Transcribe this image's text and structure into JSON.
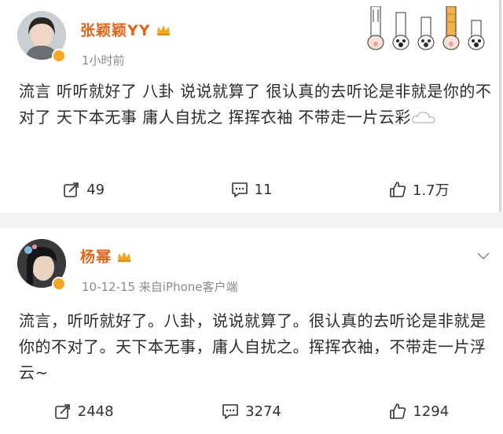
{
  "posts": [
    {
      "author": "张颖颖YY",
      "time": "1小时前",
      "text": "流言 听听就好了 八卦 说说就算了 很认真的去听论是非就是你的不对了 天下本无事 庸人自扰之 挥挥衣袖 不带走一片云彩",
      "repost_count": "49",
      "comment_count": "11",
      "like_count": "1.7万"
    },
    {
      "author": "杨幂",
      "time": "10-12-15 来自iPhone客户端",
      "text": "流言，听听就好了。八卦，说说就算了。很认真的去听论是非就是你的不对了。天下本无事，庸人自扰之。挥挥衣袖，不带走一片浮云~",
      "repost_count": "2448",
      "comment_count": "3274",
      "like_count": "1294"
    }
  ],
  "icons": {
    "repost": "repost-icon",
    "comment": "comment-icon",
    "like": "like-icon",
    "crown": "crown-badge-icon",
    "verified": "verified-badge-icon"
  },
  "colors": {
    "author_name": "#e0661a",
    "meta_text": "#8a8a8a",
    "badge": "#f5a623"
  }
}
